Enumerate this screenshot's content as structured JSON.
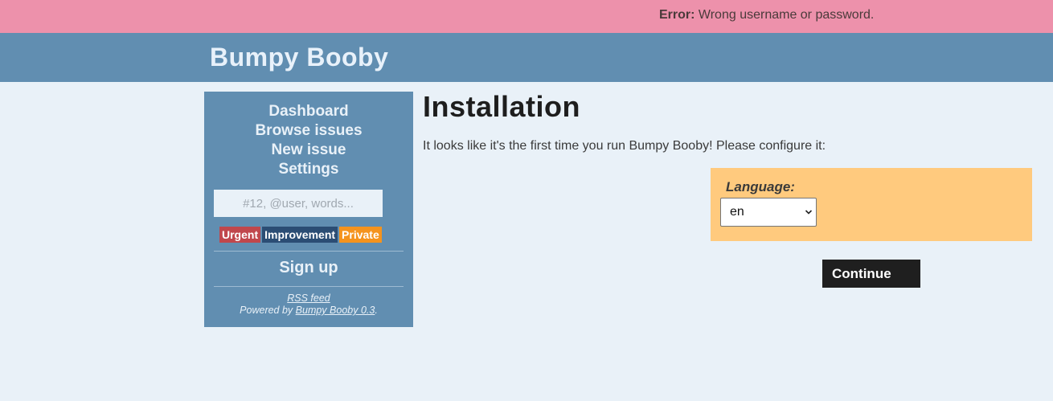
{
  "error_bar": {
    "label": "Error:",
    "message": "Wrong username or password.",
    "background": "#ed91ab"
  },
  "header": {
    "app_title": "Bumpy Booby",
    "background": "#618eb1"
  },
  "sidebar": {
    "nav": [
      {
        "label": "Dashboard"
      },
      {
        "label": "Browse issues"
      },
      {
        "label": "New issue"
      },
      {
        "label": "Settings"
      }
    ],
    "search": {
      "placeholder": "#12, @user, words...",
      "value": ""
    },
    "tags": [
      {
        "label": "Urgent",
        "color": "#c0474c"
      },
      {
        "label": "Improvement",
        "color": "#2b4d74"
      },
      {
        "label": "Private",
        "color": "#f5931d"
      }
    ],
    "signup_label": "Sign up",
    "footer": {
      "rss_label": "RSS feed",
      "powered_by_prefix": "Powered by ",
      "powered_by_link": "Bumpy Booby 0.3",
      "powered_by_suffix": "."
    }
  },
  "main": {
    "title": "Installation",
    "intro": "It looks like it's the first time you run Bumpy Booby! Please configure it:",
    "language": {
      "label": "Language:",
      "selected": "en",
      "box_color": "#ffca7e"
    },
    "continue_label": "Continue"
  }
}
